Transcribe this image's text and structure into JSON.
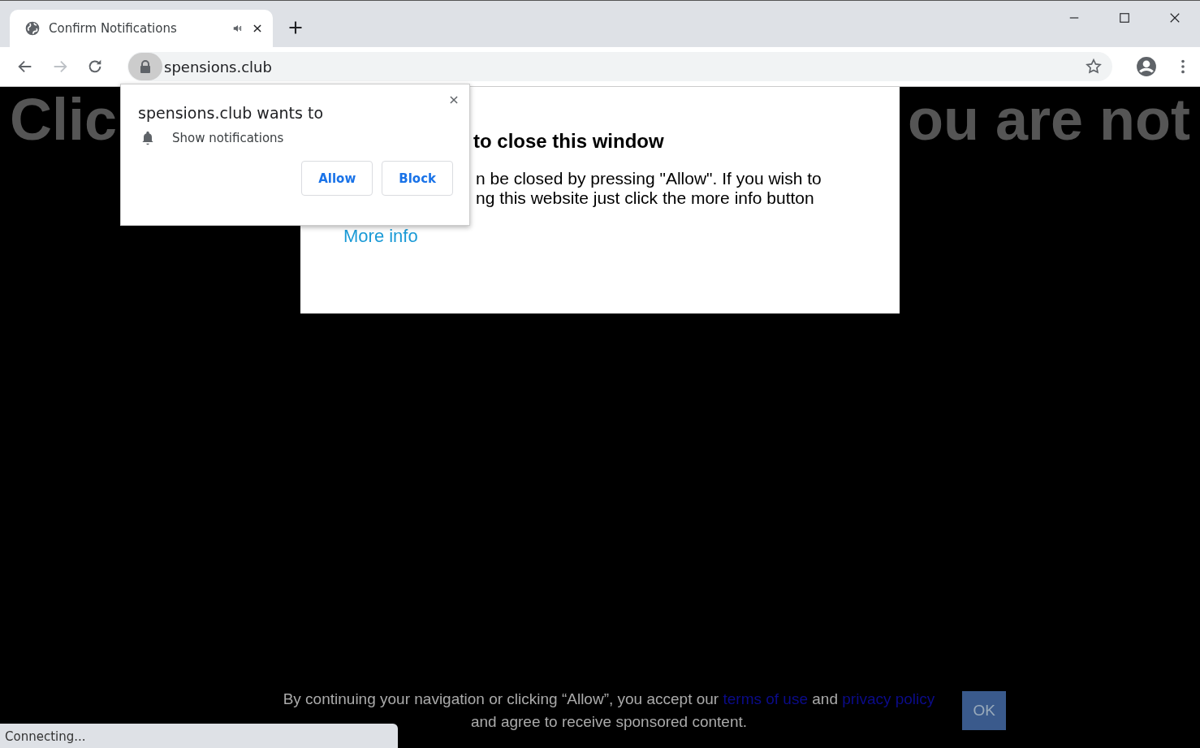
{
  "tabs": [
    {
      "title": "Confirm Notifications",
      "selected": true,
      "audio": true
    }
  ],
  "address_bar": {
    "url": "spensions.club"
  },
  "page": {
    "headline_left": "Clic",
    "headline_right": "ou are not",
    "modal": {
      "heading": "to close this window",
      "body_lines": [
        "n be closed by pressing \"Allow\". If you wish to",
        "ng this website just click the more info button"
      ],
      "link": "More info"
    },
    "consent": {
      "line1": "By continuing your navigation or clicking “Allow”, you accept our",
      "link1": "terms of use",
      "and": "and",
      "link2": "privacy policy",
      "line2": "and agree to receive sponsored content.",
      "button": "OK"
    }
  },
  "permission_popup": {
    "title": "spensions.club wants to",
    "permission": "Show notifications",
    "buttons": [
      "Allow",
      "Block"
    ]
  },
  "status_bar": "Connecting..."
}
